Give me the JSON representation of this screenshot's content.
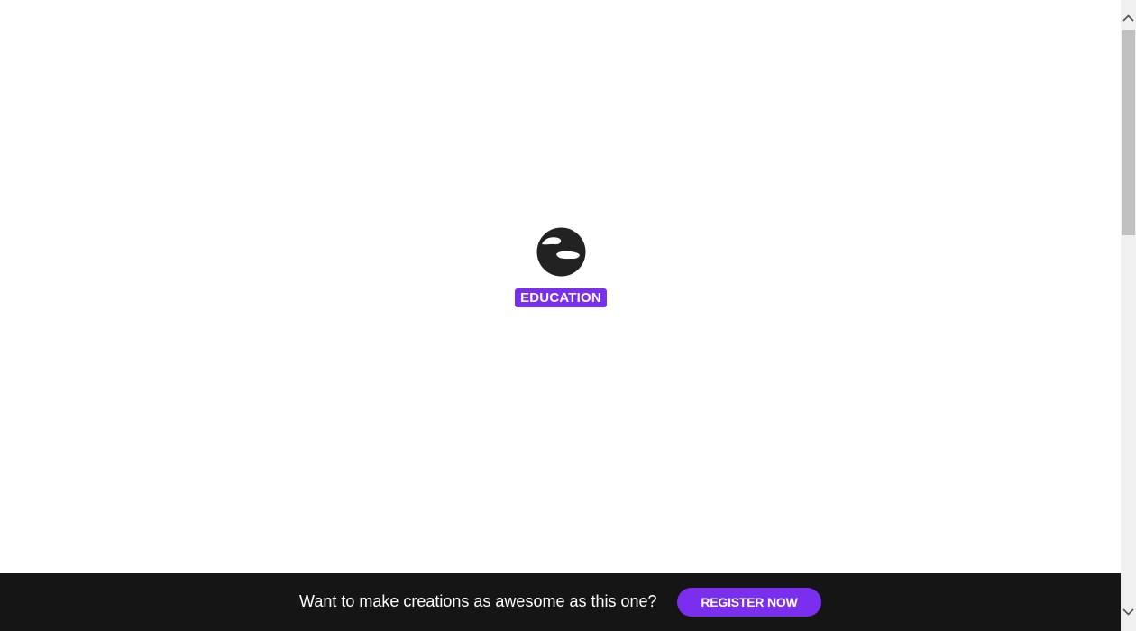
{
  "loader": {
    "logo_icon": "genially-logo-icon",
    "badge_label": "EDUCATION"
  },
  "footer": {
    "text": "Want to make creations as awesome as this one?",
    "button_label": "REGISTER NOW"
  },
  "scrollbar": {
    "up_icon": "chevron-up-icon",
    "down_icon": "chevron-down-icon"
  },
  "colors": {
    "accent": "#7b2fee",
    "footer_bg": "#151515",
    "logo": "#222222"
  }
}
